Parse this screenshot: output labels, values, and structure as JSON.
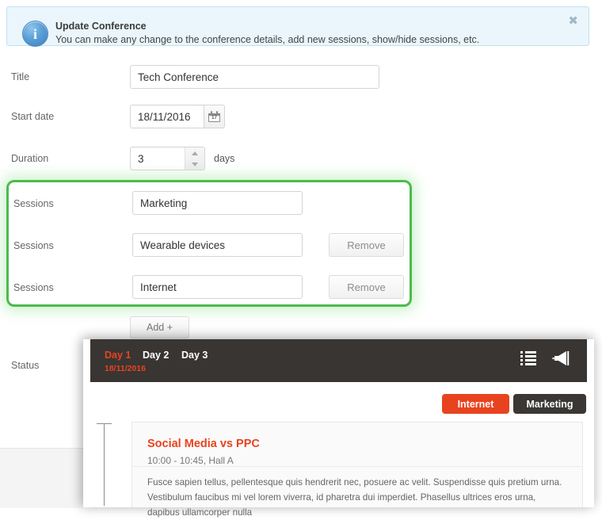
{
  "banner": {
    "title": "Update Conference",
    "description": "You can make any change to the conference details, add new sessions, show/hide sessions, etc.",
    "close_label": "✖",
    "info_glyph": "i",
    "bg_color": "#eaf6fb",
    "border_color": "#bfe2f0"
  },
  "form": {
    "title_row": {
      "label": "Title",
      "value": "Tech Conference"
    },
    "start_date_row": {
      "label": "Start date",
      "value": "18/11/2016",
      "calendar_day": "17"
    },
    "duration_row": {
      "label": "Duration",
      "value": "3",
      "unit": "days"
    },
    "status_row": {
      "label": "Status"
    },
    "add_button": "Add +"
  },
  "sessions": {
    "highlight_color": "#4cbb4c",
    "rows": [
      {
        "label": "Sessions",
        "value": "Marketing",
        "remove_label": "",
        "has_remove": false
      },
      {
        "label": "Sessions",
        "value": "Wearable devices",
        "remove_label": "Remove",
        "has_remove": true
      },
      {
        "label": "Sessions",
        "value": "Internet",
        "remove_label": "Remove",
        "has_remove": true
      }
    ]
  },
  "preview": {
    "accent_color": "#e8431f",
    "bar_color": "#383533",
    "days": [
      {
        "label": "Day 1",
        "active": true
      },
      {
        "label": "Day 2",
        "active": false
      },
      {
        "label": "Day 3",
        "active": false
      }
    ],
    "day_date": "18/11/2016",
    "icons": {
      "list": "list-icon",
      "megaphone": "megaphone-icon"
    },
    "tags": [
      {
        "label": "Internet",
        "color": "#e8431f"
      },
      {
        "label": "Marketing",
        "color": "#3a3735"
      }
    ],
    "session_card": {
      "title": "Social Media vs PPC",
      "meta": "10:00 - 10:45, Hall A",
      "body": "Fusce sapien tellus, pellentesque quis hendrerit nec, posuere ac velit. Suspendisse quis pretium urna. Vestibulum faucibus mi vel lorem viverra, id pharetra dui imperdiet. Phasellus ultrices eros urna, dapibus ullamcorper nulla"
    }
  }
}
